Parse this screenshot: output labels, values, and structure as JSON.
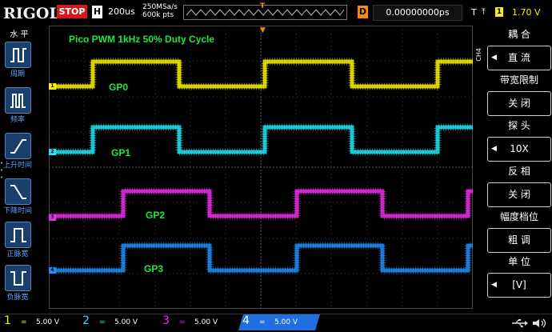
{
  "topbar": {
    "logo": "RIGOL",
    "run_state": "STOP",
    "horizontal_label": "H",
    "timebase": "200us",
    "sample_rate": "250MSa/s",
    "memory_depth": "600k pts",
    "trigger_position_marker": "T",
    "delay_label": "D",
    "delay_value": "0.00000000ps",
    "trigger_label": "T",
    "trigger_edge": "⤒",
    "trigger_channel": "1",
    "trigger_level": "1.70 V"
  },
  "left_menu": {
    "title": "水 平",
    "items": [
      {
        "label": "周期",
        "icon": "period-icon"
      },
      {
        "label": "频率",
        "icon": "frequency-icon"
      },
      {
        "label": "上升时间",
        "icon": "rise-time-icon"
      },
      {
        "label": "下降时间",
        "icon": "fall-time-icon"
      },
      {
        "label": "正脉宽",
        "icon": "positive-width-icon"
      },
      {
        "label": "负脉宽",
        "icon": "negative-width-icon"
      }
    ]
  },
  "plot": {
    "title": "Pico PWM 1kHz 50% Duty Cycle",
    "signals": [
      {
        "label": "GP0",
        "channel": "1",
        "color": "#f4f000"
      },
      {
        "label": "GP1",
        "channel": "2",
        "color": "#22e1f0"
      },
      {
        "label": "GP2",
        "channel": "3",
        "color": "#e82de8"
      },
      {
        "label": "GP3",
        "channel": "4",
        "color": "#1f8cf4"
      }
    ]
  },
  "right_menu": {
    "channel_tag": "CH4",
    "items": [
      {
        "title": "耦 合",
        "value": "直 流",
        "has_arrow": true
      },
      {
        "title": "带宽限制",
        "value": "关 闭",
        "has_arrow": false
      },
      {
        "title": "探 头",
        "value": "10X",
        "has_arrow": true
      },
      {
        "title": "反 相",
        "value": "关 闭",
        "has_arrow": false
      },
      {
        "title": "幅度档位",
        "value": "粗 调",
        "has_arrow": false
      },
      {
        "title": "单 位",
        "value": "[V]",
        "has_arrow": true
      }
    ]
  },
  "bottombar": {
    "channels": [
      {
        "num": "1",
        "coupling": "=",
        "scale": "5.00 V",
        "color": "#f4f000",
        "active": false
      },
      {
        "num": "2",
        "coupling": "=",
        "scale": "5.00 V",
        "color": "#22e1f0",
        "active": false
      },
      {
        "num": "3",
        "coupling": "=",
        "scale": "5.00 V",
        "color": "#e82de8",
        "active": false
      },
      {
        "num": "4",
        "coupling": "=",
        "scale": "5.00 V",
        "color": "#1f8cf4",
        "active": true
      }
    ],
    "usb_icon": "usb-icon",
    "sound_icon": "speaker-icon"
  }
}
